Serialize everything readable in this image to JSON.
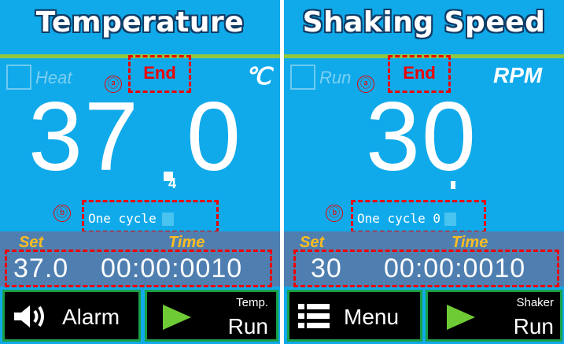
{
  "temperature_panel": {
    "title": "Temperature",
    "checkbox_label": "Heat",
    "status": "End",
    "unit": "℃",
    "value": "37.0",
    "value_int": "37",
    "value_dec": "0",
    "sub_digit": "4",
    "cycle_text": "One cycle 0",
    "set_label": "Set",
    "time_label": "Time",
    "set_value": "37.0",
    "time_value": "00:00:0010",
    "alarm_button": "Alarm",
    "run_button_top": "Temp.",
    "run_button_bottom": "Run"
  },
  "shaking_panel": {
    "title": "Shaking Speed",
    "checkbox_label": "Run",
    "status": "End",
    "unit": "RPM",
    "value": "30",
    "cycle_text": "One cycle 0",
    "set_label": "Set",
    "time_label": "Time",
    "set_value": "30",
    "time_value": "00:00:0010",
    "menu_button": "Menu",
    "run_button_top": "Shaker",
    "run_button_bottom": "Run"
  },
  "markers": {
    "a": "ⓐ",
    "b": "ⓑ"
  },
  "colors": {
    "panel_bg": "#10aaea",
    "divider": "#ffffff",
    "accent_green": "#92c83e",
    "annotation_red": "#ee0000",
    "label_yellow": "#ffbd20",
    "set_strip": "#4f7fb0",
    "button_bg": "#000000",
    "play_green": "#6fcb35"
  },
  "icons": [
    "speaker-icon",
    "menu-list-icon",
    "play-icon"
  ]
}
